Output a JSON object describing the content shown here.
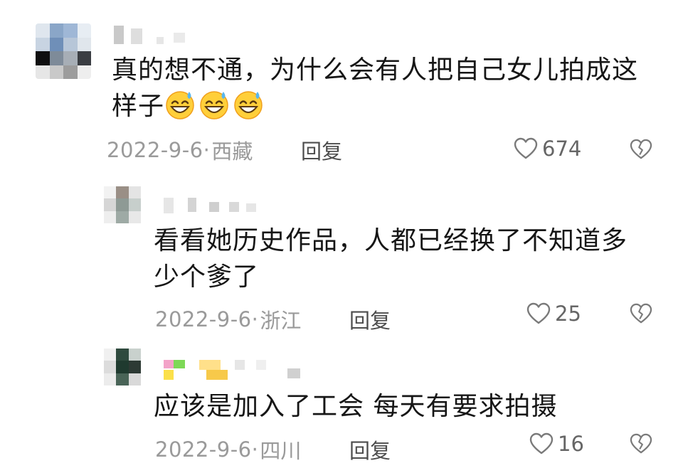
{
  "comments": [
    {
      "text_line1": "真的想不通，为什么会有人把自己女儿拍成这",
      "text_line2": "样子",
      "emoji_count": 3,
      "date": "2022-9-6·",
      "location": "西藏",
      "reply_label": "回复",
      "likes": "674"
    },
    {
      "text_line1": "看看她历史作品，人都已经换了不知道多",
      "text_line2": "少个爹了",
      "date": "2022-9-6·",
      "location": "浙江",
      "reply_label": "回复",
      "likes": "25"
    },
    {
      "text_line1": "应该是加入了工会 每天有要求拍摄",
      "date": "2022-9-6·",
      "location": "四川",
      "reply_label": "回复",
      "likes": "16"
    }
  ],
  "colors": {
    "text": "#161616",
    "meta": "#9a9a9a",
    "reply": "#4d4d4d",
    "icon": "#7a7a7a"
  }
}
